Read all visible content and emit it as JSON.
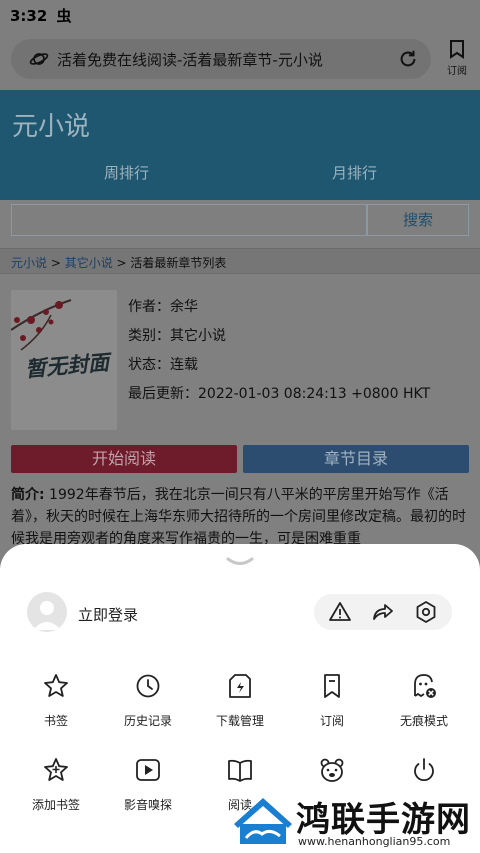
{
  "status_bar": {
    "time": "3:32",
    "notification_glyph": "虫"
  },
  "address_bar": {
    "page_title": "活着免费在线阅读-活着最新章节-元小说",
    "subscribe_label": "订阅"
  },
  "site": {
    "name": "元小说",
    "rank_tabs": [
      "周排行",
      "月排行"
    ],
    "search_button": "搜索",
    "search_value": ""
  },
  "breadcrumb": {
    "home": "元小说",
    "sep1": " > ",
    "category": "其它小说",
    "sep2": " > ",
    "current": "活着最新章节列表"
  },
  "book": {
    "cover_text": "暂无封面",
    "author": "作者：余华",
    "category": "类别：其它小说",
    "status": "状态：连载",
    "last_update": "最后更新：2022-01-03 08:24:13 +0800 HKT",
    "start_reading": "开始阅读",
    "chapter_list": "章节目录",
    "intro_label": "简介:",
    "intro_text": " 1992年春节后，我在北京一间只有八平米的平房里开始写作《活着》，秋天的时候在上海华东师大招待所的一个房间里修改定稿。最初的时候我是用旁观者的角度来写作福贵的一生，可是困难重重"
  },
  "sheet": {
    "login": "立即登录",
    "menu": [
      {
        "label": "书签",
        "icon": "star-icon"
      },
      {
        "label": "历史记录",
        "icon": "clock-icon"
      },
      {
        "label": "下载管理",
        "icon": "download-icon"
      },
      {
        "label": "订阅",
        "icon": "bookmark-icon"
      },
      {
        "label": "无痕模式",
        "icon": "ghost-icon"
      },
      {
        "label": "添加书签",
        "icon": "star-add-icon"
      },
      {
        "label": "影音嗅探",
        "icon": "video-icon"
      },
      {
        "label": "阅读",
        "icon": "book-icon"
      },
      {
        "label": "",
        "icon": "bear-icon"
      },
      {
        "label": "",
        "icon": "power-icon"
      }
    ]
  },
  "watermark": {
    "title": "鸿联手游网",
    "url": "www.henanhonglian95.com"
  },
  "colors": {
    "header": "#1f5670",
    "start_button": "#6e1b2c",
    "toc_button": "#2c4d70",
    "sheet": "#ffffff"
  }
}
